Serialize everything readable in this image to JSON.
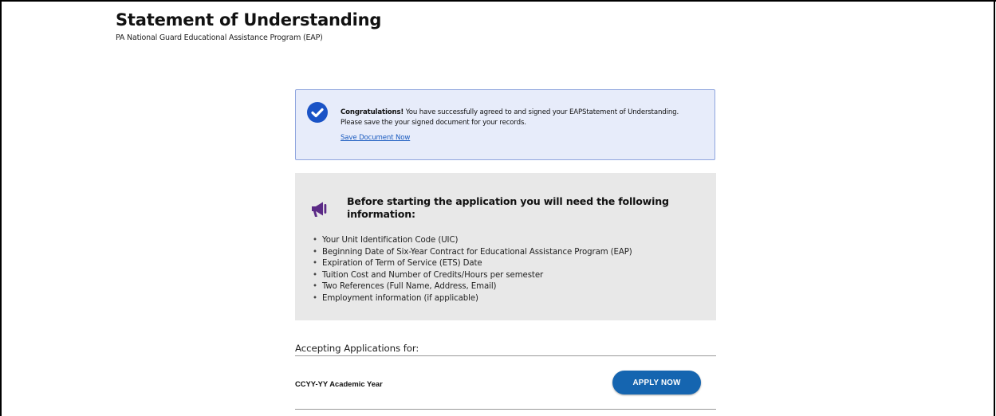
{
  "header": {
    "title": "Statement of Understanding",
    "subtitle": "PA National Guard Educational Assistance Program (EAP)"
  },
  "success_banner": {
    "icon": "check-circle-icon",
    "strong": "Congratulations!",
    "message": "You have successfully agreed to and signed your EAPStatement of Understanding. Please save the your signed document for your records.",
    "link_label": "Save Document Now",
    "accent_color": "#1a53c6"
  },
  "info_panel": {
    "icon": "megaphone-icon",
    "heading": "Before starting the application you will need the following information:",
    "items": [
      "Your Unit Identification Code (UIC)",
      "Beginning Date of Six-Year Contract for Educational Assistance Program (EAP)",
      "Expiration of Term of Service (ETS) Date",
      "Tuition Cost and Number of Credits/Hours per semester",
      "Two References (Full Name, Address, Email)",
      "Employment information (if applicable)"
    ],
    "icon_color": "#5b2a86"
  },
  "applications": {
    "label": "Accepting Applications for:",
    "year_label": "CCYY-YY Academic Year",
    "apply_button": "APPLY NOW",
    "button_color": "#1565b0"
  }
}
